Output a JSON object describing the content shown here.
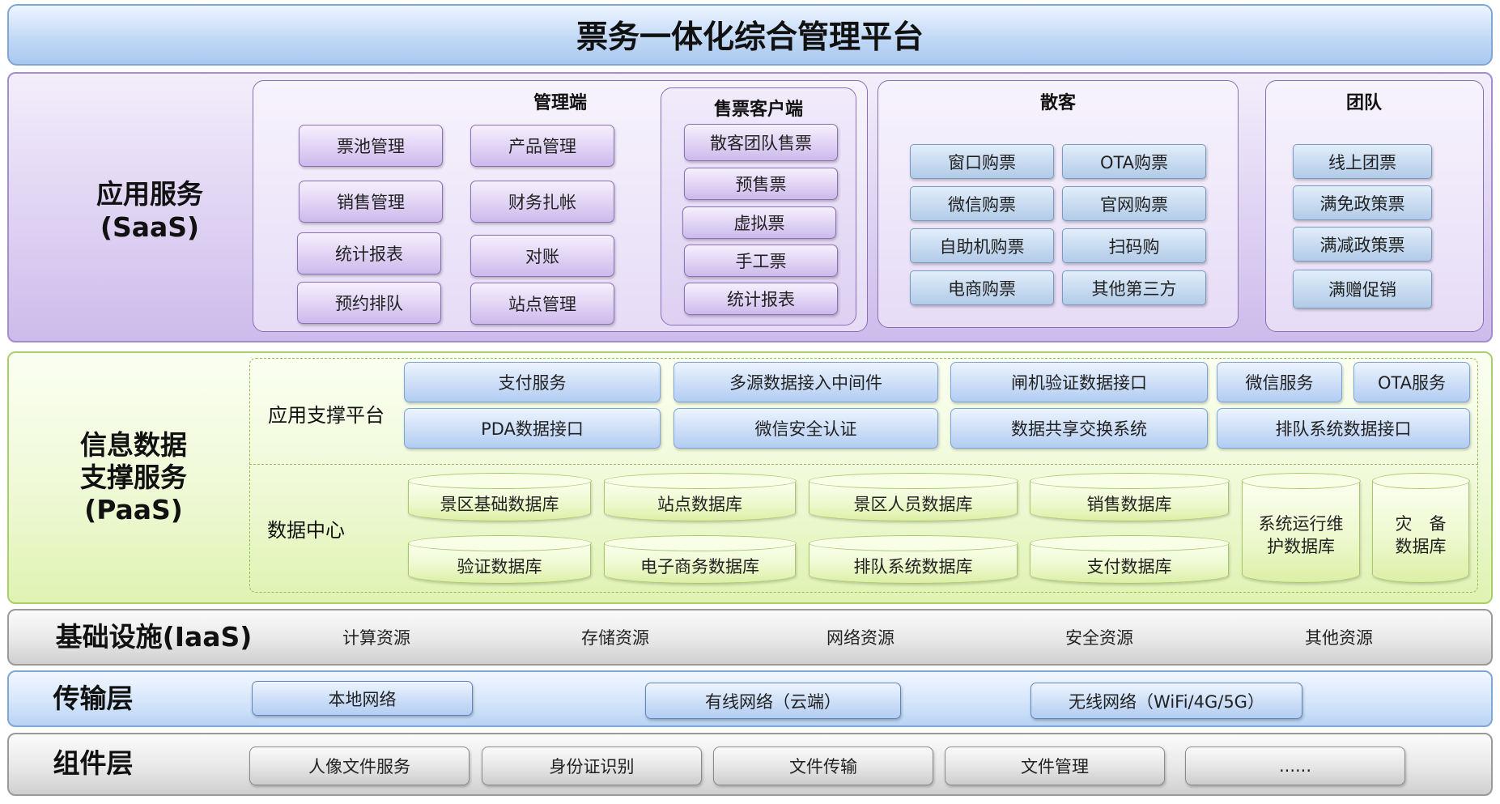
{
  "title": "票务一体化综合管理平台",
  "saas": {
    "label_line1": "应用服务",
    "label_line2": "(SaaS)",
    "management": {
      "title": "管理端",
      "items": [
        "票池管理",
        "产品管理",
        "销售管理",
        "财务扎帐",
        "统计报表",
        "对账",
        "预约排队",
        "站点管理"
      ]
    },
    "ticket_client": {
      "title": "售票客户端",
      "items": [
        "散客团队售票",
        "预售票",
        "虚拟票",
        "手工票",
        "统计报表"
      ]
    },
    "individual": {
      "title": "散客",
      "items": [
        "窗口购票",
        "OTA购票",
        "微信购票",
        "官网购票",
        "自助机购票",
        "扫码购",
        "电商购票",
        "其他第三方"
      ]
    },
    "group_tourists": {
      "title": "团队",
      "items": [
        "线上团票",
        "满免政策票",
        "满减政策票",
        "满赠促销"
      ]
    }
  },
  "paas": {
    "label_line1": "信息数据",
    "label_line2": "支撑服务",
    "label_line3": "(PaaS)",
    "support_platform": {
      "label": "应用支撑平台",
      "items": [
        "支付服务",
        "多源数据接入中间件",
        "闸机验证数据接口",
        "微信服务",
        "OTA服务",
        "PDA数据接口",
        "微信安全认证",
        "数据共享交换系统",
        "排队系统数据接口"
      ]
    },
    "data_center": {
      "label": "数据中心",
      "items": [
        "景区基础数据库",
        "站点数据库",
        "景区人员数据库",
        "销售数据库",
        "验证数据库",
        "电子商务数据库",
        "排队系统数据库",
        "支付数据库"
      ],
      "tall_items": [
        {
          "line1": "系统运行维",
          "line2": "护数据库"
        },
        {
          "line1": "灾　备",
          "line2": "数据库"
        }
      ]
    }
  },
  "iaas": {
    "label": "基础设施(IaaS)",
    "items": [
      "计算资源",
      "存储资源",
      "网络资源",
      "安全资源",
      "其他资源"
    ]
  },
  "transport": {
    "label": "传输层",
    "items": [
      "本地网络",
      "有线网络（云端）",
      "无线网络（WiFi/4G/5G）"
    ]
  },
  "components": {
    "label": "组件层",
    "items": [
      "人像文件服务",
      "身份证识别",
      "文件传输",
      "文件管理",
      "......"
    ]
  },
  "colors": {
    "saas_band": "#d9ccef",
    "paas_band": "#e8f6c4",
    "iaas_band": "#e3e3e3",
    "transport_band": "#cadef7",
    "title_bar": "#bcd5f5"
  }
}
